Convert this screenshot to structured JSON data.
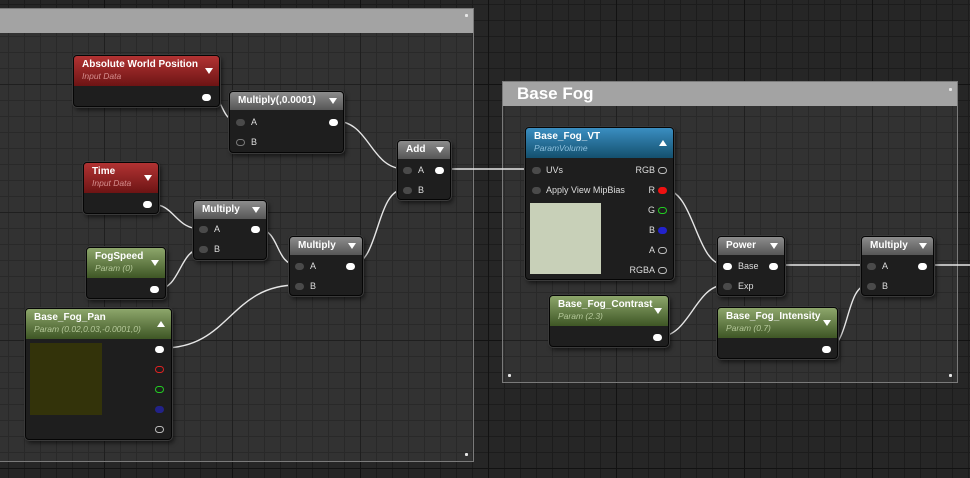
{
  "comments": {
    "base_fog_title": "Base Fog"
  },
  "nodes": {
    "abs_world_pos": {
      "title": "Absolute World Position",
      "subtitle": "Input Data"
    },
    "multiply_const": {
      "title": "Multiply(,0.0001)",
      "pin_a": "A",
      "pin_b": "B"
    },
    "time": {
      "title": "Time",
      "subtitle": "Input Data"
    },
    "multiply_1": {
      "title": "Multiply",
      "pin_a": "A",
      "pin_b": "B"
    },
    "fog_speed": {
      "title": "FogSpeed",
      "subtitle": "Param (0)"
    },
    "multiply_2": {
      "title": "Multiply",
      "pin_a": "A",
      "pin_b": "B"
    },
    "add": {
      "title": "Add",
      "pin_a": "A",
      "pin_b": "B"
    },
    "base_fog_pan": {
      "title": "Base_Fog_Pan",
      "subtitle": "Param (0.02,0.03,-0.0001,0)",
      "swatch_color": "#33330a"
    },
    "base_fog_vt": {
      "title": "Base_Fog_VT",
      "subtitle": "ParamVolume",
      "inputs": [
        "UVs",
        "Apply View MipBias"
      ],
      "outputs": [
        "RGB",
        "R",
        "G",
        "B",
        "A",
        "RGBA"
      ],
      "swatch_color": "#c8d0b8"
    },
    "base_fog_contrast": {
      "title": "Base_Fog_Contrast",
      "subtitle": "Param (2.3)"
    },
    "power": {
      "title": "Power",
      "pin_base": "Base",
      "pin_exp": "Exp"
    },
    "base_fog_intensity": {
      "title": "Base_Fog_Intensity",
      "subtitle": "Param (0.7)"
    },
    "multiply_3": {
      "title": "Multiply",
      "pin_a": "A",
      "pin_b": "B"
    }
  },
  "colors": {
    "input_node": "#9a2222",
    "param_node": "#5e7a3c",
    "texture_node": "#2a78a8",
    "math_node": "#747474",
    "wire": "#e6e6e6"
  },
  "icons": [
    "dropdown-caret-icon",
    "collapse-caret-icon",
    "pin-dot-icon"
  ]
}
